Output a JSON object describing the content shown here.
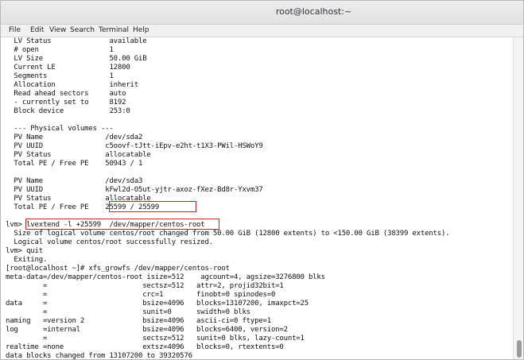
{
  "window": {
    "title": "root@localhost:~"
  },
  "menubar": {
    "items": [
      "File",
      "Edit",
      "View",
      "Search",
      "Terminal",
      "Help"
    ]
  },
  "terminal": {
    "lines": [
      "  LV Status              available",
      "  # open                 1",
      "  LV Size                50.00 GiB",
      "  Current LE             12800",
      "  Segments               1",
      "  Allocation             inherit",
      "  Read ahead sectors     auto",
      "  - currently set to     8192",
      "  Block device           253:0",
      "",
      "  --- Physical volumes ---",
      "  PV Name               /dev/sda2",
      "  PV UUID               c5oovf-tJtt-iEpv-e2ht-t1X3-PWil-HSWoY9",
      "  PV Status             allocatable",
      "  Total PE / Free PE    50943 / 1",
      "",
      "  PV Name               /dev/sda3",
      "  PV UUID               kFwl2d-O5ut-yjtr-axoz-fXez-Bd8r-Yxvm37",
      "  PV Status             allocatable",
      "  Total PE / Free PE    25599 / 25599",
      "",
      "lvm> lvextend -l +25599  /dev/mapper/centos-root",
      "  Size of logical volume centos/root changed from 50.00 GiB (12800 extents) to <150.00 GiB (38399 extents).",
      "  Logical volume centos/root successfully resized.",
      "lvm> quit",
      "  Exiting.",
      "[root@localhost ~]# xfs_growfs /dev/mapper/centos-root",
      "meta-data=/dev/mapper/centos-root isize=512    agcount=4, agsize=3276800 blks",
      "         =                       sectsz=512   attr=2, projid32bit=1",
      "         =                       crc=1        finobt=0 spinodes=0",
      "data     =                       bsize=4096   blocks=13107200, imaxpct=25",
      "         =                       sunit=0      swidth=0 blks",
      "naming   =version 2              bsize=4096   ascii-ci=0 ftype=1",
      "log      =internal               bsize=4096   blocks=6400, version=2",
      "         =                       sectsz=512   sunit=0 blks, lazy-count=1",
      "realtime =none                   extsz=4096   blocks=0, rtextents=0",
      "data blocks changed from 13107200 to 39320576"
    ]
  },
  "colors": {
    "highlight": "#d9201e",
    "text": "#111111",
    "background": "#ffffff"
  }
}
